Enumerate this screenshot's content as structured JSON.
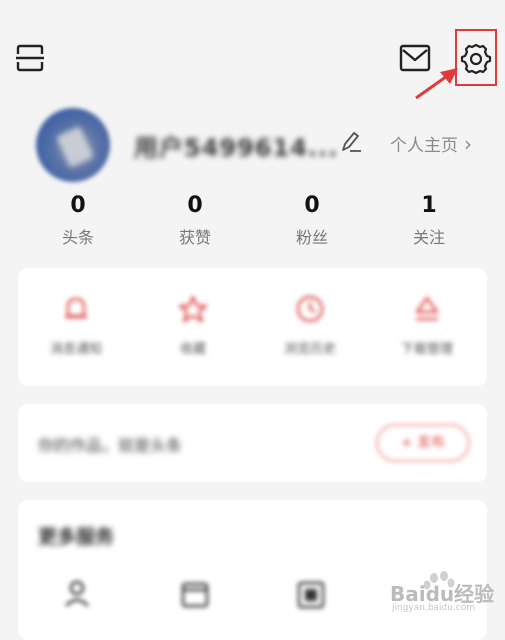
{
  "header": {
    "icons": [
      "scan-icon",
      "mail-icon",
      "gear-icon"
    ],
    "highlight_color": "#e23a3a"
  },
  "profile": {
    "username": "用户5499614...",
    "homepage_label": "个人主页",
    "homepage_chevron": "›"
  },
  "stats": [
    {
      "value": "0",
      "label": "头条"
    },
    {
      "value": "0",
      "label": "获赞"
    },
    {
      "value": "0",
      "label": "粉丝"
    },
    {
      "value": "1",
      "label": "关注"
    }
  ],
  "quick_actions": [
    {
      "icon": "bell-icon",
      "label": "消息通知"
    },
    {
      "icon": "star-icon",
      "label": "收藏"
    },
    {
      "icon": "clock-icon",
      "label": "浏览历史"
    },
    {
      "icon": "download-icon",
      "label": "下载管理"
    }
  ],
  "promo": {
    "text": "你的作品，就是头条",
    "button_label": "+ 发布"
  },
  "more_services": {
    "title": "更多服务",
    "icons": [
      "user-icon",
      "calendar-icon",
      "qrcode-icon"
    ]
  },
  "watermark": {
    "text": "Baidu经验",
    "sub": "jingyan.baidu.com"
  },
  "colors": {
    "accent_red": "#e05050",
    "background": "#f4f4f4"
  }
}
